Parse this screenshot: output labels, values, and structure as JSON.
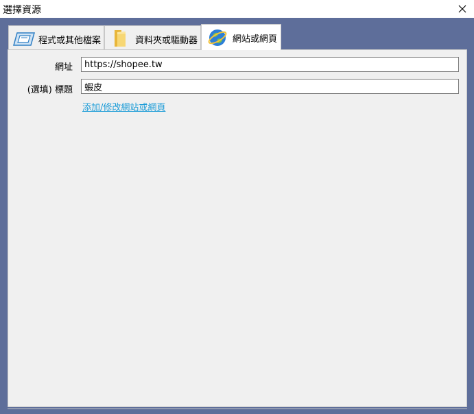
{
  "window": {
    "title": "選擇資源",
    "close_icon": "close-icon"
  },
  "tabs": [
    {
      "label": "程式或其他檔案",
      "icon": "application-icon",
      "active": false
    },
    {
      "label": "資料夾或驅動器",
      "icon": "folder-icon",
      "active": false
    },
    {
      "label": "網站或網頁",
      "icon": "globe-icon",
      "active": true
    }
  ],
  "form": {
    "url_label": "網址",
    "url_value": "https://shopee.tw",
    "title_label": "(選填) 標題",
    "title_value": "蝦皮",
    "link_text": "添加/修改網站或網頁"
  },
  "colors": {
    "frame": "#5e6e9a",
    "link": "#1a9bd7",
    "panel": "#f0f0f0"
  }
}
